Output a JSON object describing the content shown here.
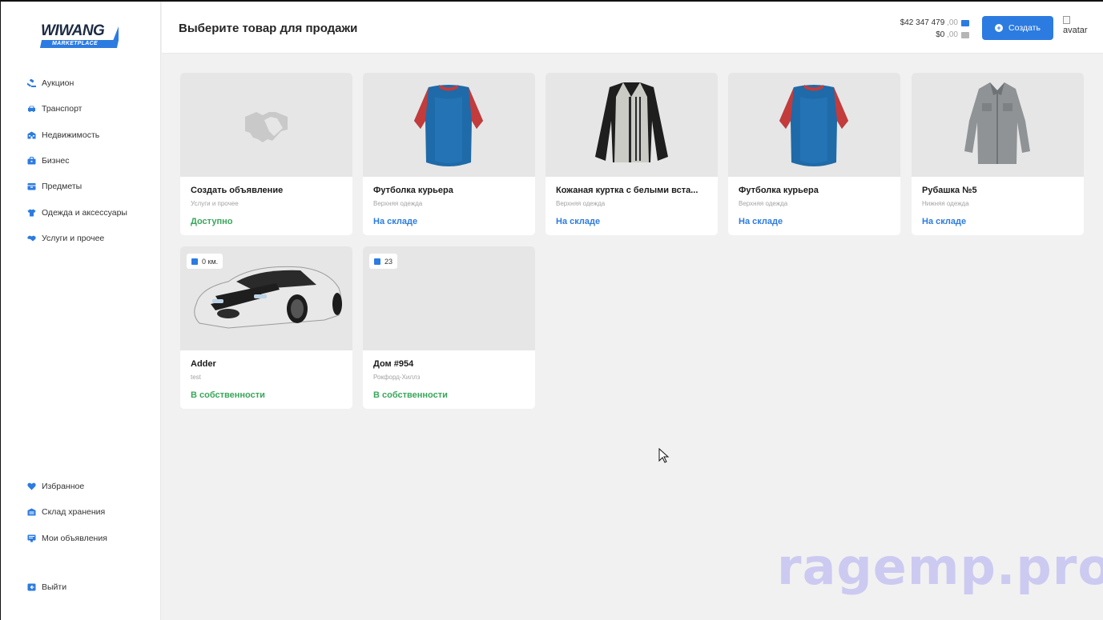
{
  "brand": {
    "name": "WIWANG",
    "sub": "MARKETPLACE"
  },
  "sidebar": {
    "main": [
      {
        "label": "Аукцион",
        "icon": "gavel-icon"
      },
      {
        "label": "Транспорт",
        "icon": "car-icon"
      },
      {
        "label": "Недвижимость",
        "icon": "building-icon"
      },
      {
        "label": "Бизнес",
        "icon": "briefcase-icon"
      },
      {
        "label": "Предметы",
        "icon": "box-icon"
      },
      {
        "label": "Одежда и аксессуары",
        "icon": "shirt-icon"
      },
      {
        "label": "Услуги и прочее",
        "icon": "handshake-icon"
      }
    ],
    "bottom": [
      {
        "label": "Избранное",
        "icon": "heart-icon"
      },
      {
        "label": "Склад хранения",
        "icon": "warehouse-icon"
      },
      {
        "label": "Мои объявления",
        "icon": "list-icon"
      }
    ],
    "exit": {
      "label": "Выйти",
      "icon": "logout-icon"
    }
  },
  "header": {
    "title": "Выберите товар для продажи",
    "balance_cash": "$42 347 479",
    "balance_cash_cents": ",00",
    "balance_bank": "$0",
    "balance_bank_cents": ",00",
    "create_label": "Создать",
    "avatar_alt": "avatar"
  },
  "cards": [
    {
      "title": "Создать объявление",
      "subtitle": "Услуги и прочее",
      "status": "Доступно",
      "status_color": "#38a65a",
      "image": "handshake-icon"
    },
    {
      "title": "Футболка курьера",
      "subtitle": "Верхняя одежда",
      "status": "На складе",
      "status_color": "#2c7be0",
      "image": "tshirt-image"
    },
    {
      "title": "Кожаная куртка с белыми вста...",
      "subtitle": "Верхняя одежда",
      "status": "На складе",
      "status_color": "#2c7be0",
      "image": "jacket-image"
    },
    {
      "title": "Футболка курьера",
      "subtitle": "Верхняя одежда",
      "status": "На складе",
      "status_color": "#2c7be0",
      "image": "tshirt-image"
    },
    {
      "title": "Рубашка №5",
      "subtitle": "Нижняя одежда",
      "status": "На складе",
      "status_color": "#2c7be0",
      "image": "shirt-image"
    },
    {
      "title": "Adder",
      "subtitle": "test",
      "status": "В собственности",
      "status_color": "#38a65a",
      "image": "car-image",
      "badge": "0 км."
    },
    {
      "title": "Дом #954",
      "subtitle": "Рокфорд-Хиллз",
      "status": "В собственности",
      "status_color": "#38a65a",
      "image": "house-image",
      "badge": "23"
    }
  ],
  "watermark": "ragemp.pro",
  "colors": {
    "accent": "#2c7be0",
    "green": "#38a65a",
    "background": "#f1f1f1"
  }
}
